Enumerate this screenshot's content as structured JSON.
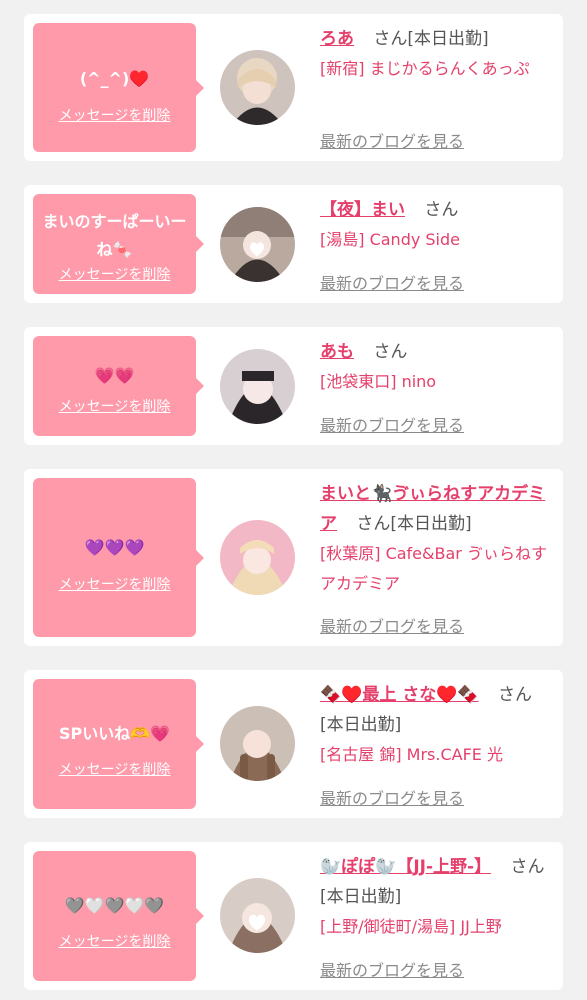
{
  "delete_label": "メッセージを削除",
  "blog_label": "最新のブログを見る",
  "san_label": "さん",
  "cards": [
    {
      "message": "(^_^)♥️",
      "name": "ろあ",
      "status": "[本日出勤]",
      "shop": "[新宿] まじかるらんくあっぷ"
    },
    {
      "message": "まいのすーぱーいーね🍬",
      "name": "【夜】まい",
      "status": "",
      "shop": "[湯島] Candy Side"
    },
    {
      "message": "💗💗",
      "name": "あも",
      "status": "",
      "shop": "[池袋東口] nino"
    },
    {
      "message": "💜💜💜",
      "name": "まいと🐈‍⬛ゔぃらねすアカデミア",
      "status": "[本日出勤]",
      "shop": "[秋葉原] Cafe&Bar ゔぃらねすアカデミア"
    },
    {
      "message": "SPいいね🫶💗",
      "name": "🍫♥️最上 さな♥️🍫",
      "status": "[本日出勤]",
      "shop": "[名古屋 錦] Mrs.CAFE 光"
    },
    {
      "message": "🩶🤍🩶🤍🩶",
      "name": "🦭ぽぽ🦭【JJ-上野-】",
      "status": "[本日出勤]",
      "shop": "[上野/御徒町/湯島] JJ上野"
    }
  ]
}
